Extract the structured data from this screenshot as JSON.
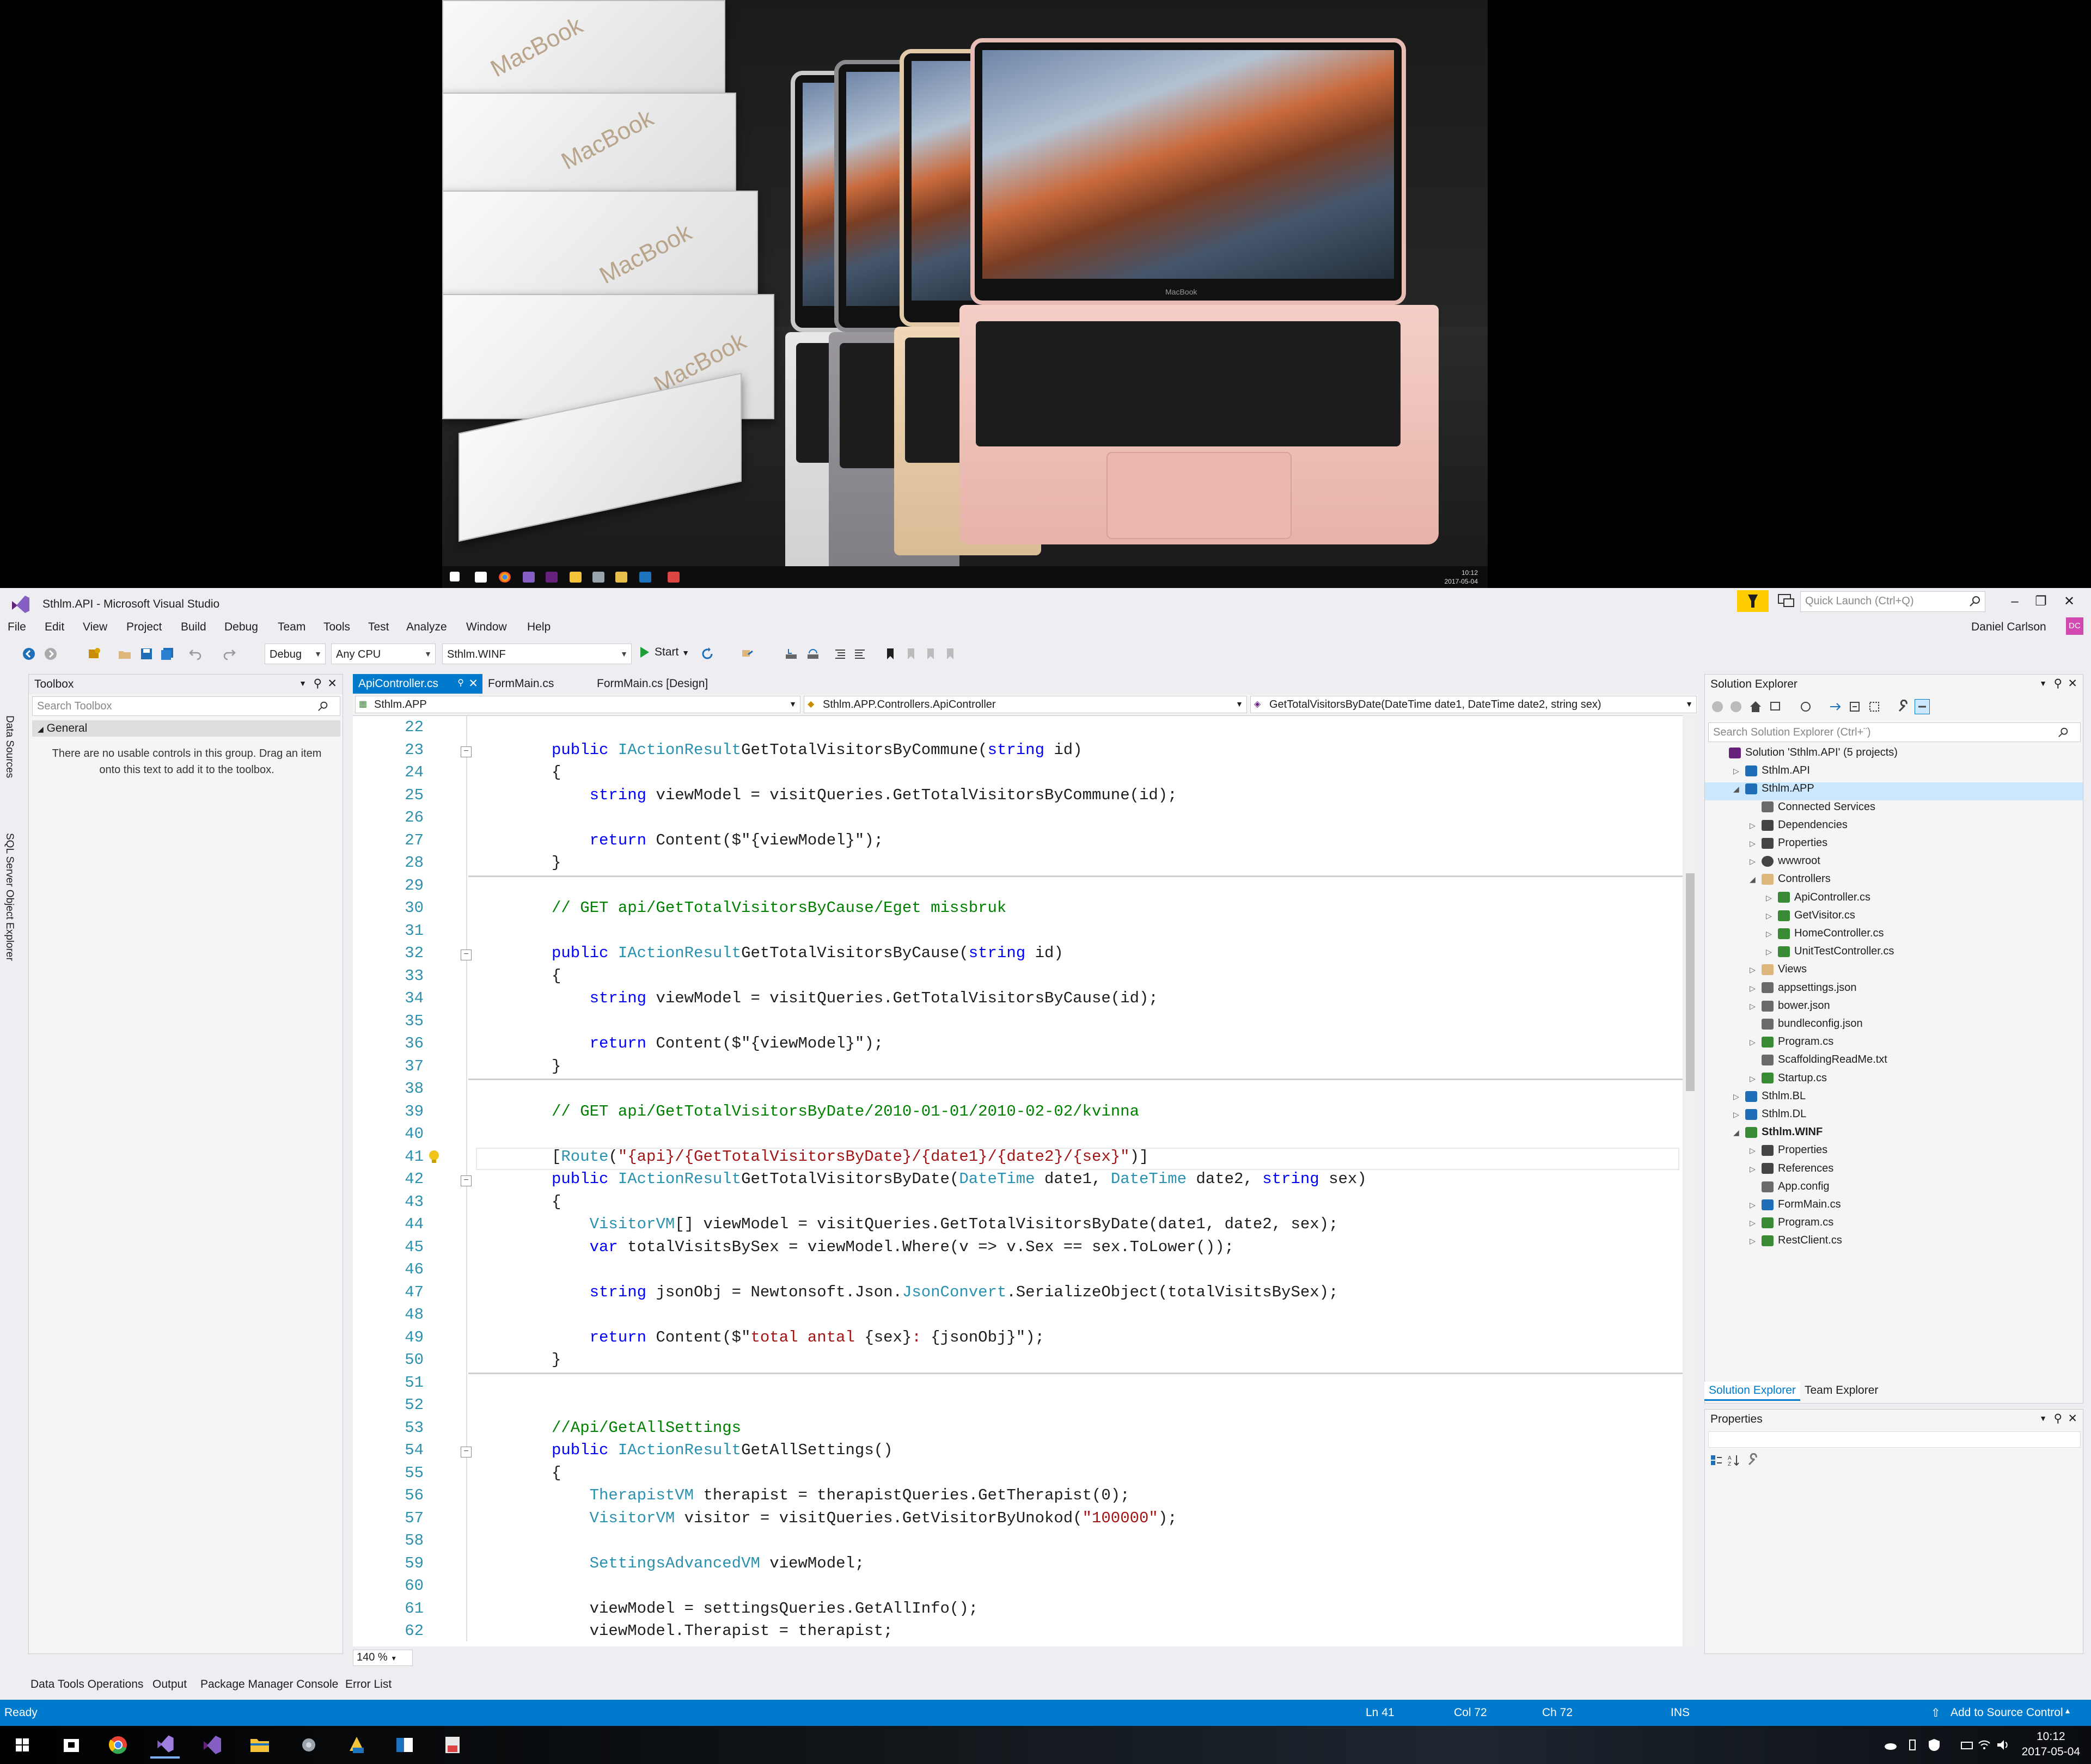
{
  "top_monitor": {
    "box_brand": "MacBook",
    "laptop_brand": "MacBook",
    "taskbar_time": "10:12",
    "taskbar_date": "2017-05-04"
  },
  "vs": {
    "window_title": "Sthlm.API - Microsoft Visual Studio",
    "quick_launch_placeholder": "Quick Launch (Ctrl+Q)",
    "user_name": "Daniel Carlson",
    "user_initials": "DC",
    "menu": [
      "File",
      "Edit",
      "View",
      "Project",
      "Build",
      "Debug",
      "Team",
      "Tools",
      "Test",
      "Analyze",
      "Window",
      "Help"
    ],
    "toolbar": {
      "config": "Debug",
      "platform": "Any CPU",
      "startup_project": "Sthlm.WINF",
      "start_label": "Start"
    },
    "side_tabs": [
      "Data Sources",
      "SQL Server Object Explorer"
    ],
    "toolbox": {
      "title": "Toolbox",
      "search_placeholder": "Search Toolbox",
      "group": "General",
      "empty_text": "There are no usable controls in this group. Drag an item onto this text to add it to the toolbox."
    },
    "doc_tabs": [
      "ApiController.cs",
      "FormMain.cs",
      "FormMain.cs [Design]"
    ],
    "nav": {
      "project": "Sthlm.APP",
      "class": "Sthlm.APP.Controllers.ApiController",
      "member": "GetTotalVisitorsByDate(DateTime date1, DateTime date2, string sex)"
    },
    "zoom": "140 %",
    "code_lines": [
      {
        "n": "22",
        "segs": []
      },
      {
        "n": "23",
        "segs": [
          [
            "kw",
            "public "
          ],
          [
            "ty",
            "IActionResult"
          ],
          [
            "",
            "GetTotalVisitorsByCommune("
          ],
          [
            "kw",
            "string"
          ],
          [
            "",
            " id)"
          ]
        ]
      },
      {
        "n": "24",
        "segs": [
          [
            "",
            "{"
          ]
        ]
      },
      {
        "n": "25",
        "segs": [
          [
            "",
            "    "
          ],
          [
            "kw",
            "string"
          ],
          [
            "",
            " viewModel = visitQueries.GetTotalVisitorsByCommune(id);"
          ]
        ]
      },
      {
        "n": "26",
        "segs": []
      },
      {
        "n": "27",
        "segs": [
          [
            "",
            "    "
          ],
          [
            "kw",
            "return"
          ],
          [
            "",
            " Content($\""
          ],
          [
            "",
            "{viewModel}"
          ],
          [
            "",
            "\");"
          ]
        ]
      },
      {
        "n": "28",
        "segs": [
          [
            "",
            "}"
          ]
        ]
      },
      {
        "n": "29",
        "segs": []
      },
      {
        "n": "30",
        "segs": [
          [
            "cm",
            "// GET api/GetTotalVisitorsByCause/Eget missbruk"
          ]
        ]
      },
      {
        "n": "31",
        "segs": []
      },
      {
        "n": "32",
        "segs": [
          [
            "kw",
            "public "
          ],
          [
            "ty",
            "IActionResult"
          ],
          [
            "",
            "GetTotalVisitorsByCause("
          ],
          [
            "kw",
            "string"
          ],
          [
            "",
            " id)"
          ]
        ]
      },
      {
        "n": "33",
        "segs": [
          [
            "",
            "{"
          ]
        ]
      },
      {
        "n": "34",
        "segs": [
          [
            "",
            "    "
          ],
          [
            "kw",
            "string"
          ],
          [
            "",
            " viewModel = visitQueries.GetTotalVisitorsByCause(id);"
          ]
        ]
      },
      {
        "n": "35",
        "segs": []
      },
      {
        "n": "36",
        "segs": [
          [
            "",
            "    "
          ],
          [
            "kw",
            "return"
          ],
          [
            "",
            " Content($\""
          ],
          [
            "",
            "{viewModel}"
          ],
          [
            "",
            "\");"
          ]
        ]
      },
      {
        "n": "37",
        "segs": [
          [
            "",
            "}"
          ]
        ]
      },
      {
        "n": "38",
        "segs": []
      },
      {
        "n": "39",
        "segs": [
          [
            "cm",
            "// GET api/GetTotalVisitorsByDate/2010-01-01/2010-02-02/kvinna"
          ]
        ]
      },
      {
        "n": "40",
        "segs": []
      },
      {
        "n": "41",
        "segs": [
          [
            "",
            "["
          ],
          [
            "ty",
            "Route"
          ],
          [
            "",
            "("
          ],
          [
            "st",
            "\"{api}/{GetTotalVisitorsByDate}/{date1}/{date2}/{sex}\""
          ],
          [
            "",
            ")]"
          ]
        ]
      },
      {
        "n": "42",
        "segs": [
          [
            "kw",
            "public "
          ],
          [
            "ty",
            "IActionResult"
          ],
          [
            "",
            "GetTotalVisitorsByDate("
          ],
          [
            "ty",
            "DateTime"
          ],
          [
            "",
            " date1, "
          ],
          [
            "ty",
            "DateTime"
          ],
          [
            "",
            " date2, "
          ],
          [
            "kw",
            "string"
          ],
          [
            "",
            " sex)"
          ]
        ]
      },
      {
        "n": "43",
        "segs": [
          [
            "",
            "{"
          ]
        ]
      },
      {
        "n": "44",
        "segs": [
          [
            "",
            "    "
          ],
          [
            "ty",
            "VisitorVM"
          ],
          [
            "",
            "[] viewModel = visitQueries.GetTotalVisitorsByDate(date1, date2, sex);"
          ]
        ]
      },
      {
        "n": "45",
        "segs": [
          [
            "",
            "    "
          ],
          [
            "kw",
            "var"
          ],
          [
            "",
            " totalVisitsBySex = viewModel.Where(v => v.Sex == sex.ToLower());"
          ]
        ]
      },
      {
        "n": "46",
        "segs": []
      },
      {
        "n": "47",
        "segs": [
          [
            "",
            "    "
          ],
          [
            "kw",
            "string"
          ],
          [
            "",
            " jsonObj = Newtonsoft.Json."
          ],
          [
            "ty",
            "JsonConvert"
          ],
          [
            "",
            ".SerializeObject(totalVisitsBySex);"
          ]
        ]
      },
      {
        "n": "48",
        "segs": []
      },
      {
        "n": "49",
        "segs": [
          [
            "",
            "    "
          ],
          [
            "kw",
            "return"
          ],
          [
            "",
            " Content($\""
          ],
          [
            "st",
            "total antal "
          ],
          [
            "",
            "{sex}"
          ],
          [
            "st",
            ": "
          ],
          [
            "",
            "{jsonObj}"
          ],
          [
            "",
            "\");"
          ]
        ]
      },
      {
        "n": "50",
        "segs": [
          [
            "",
            "}"
          ]
        ]
      },
      {
        "n": "51",
        "segs": []
      },
      {
        "n": "52",
        "segs": []
      },
      {
        "n": "53",
        "segs": [
          [
            "cm",
            "//Api/GetAllSettings"
          ]
        ]
      },
      {
        "n": "54",
        "segs": [
          [
            "kw",
            "public "
          ],
          [
            "ty",
            "IActionResult"
          ],
          [
            "",
            "GetAllSettings()"
          ]
        ]
      },
      {
        "n": "55",
        "segs": [
          [
            "",
            "{"
          ]
        ]
      },
      {
        "n": "56",
        "segs": [
          [
            "",
            "    "
          ],
          [
            "ty",
            "TherapistVM"
          ],
          [
            "",
            " therapist = therapistQueries.GetTherapist(0);"
          ]
        ]
      },
      {
        "n": "57",
        "segs": [
          [
            "",
            "    "
          ],
          [
            "ty",
            "VisitorVM"
          ],
          [
            "",
            " visitor = visitQueries.GetVisitorByUnokod("
          ],
          [
            "st",
            "\"100000\""
          ],
          [
            "",
            ");"
          ]
        ]
      },
      {
        "n": "58",
        "segs": []
      },
      {
        "n": "59",
        "segs": [
          [
            "",
            "    "
          ],
          [
            "ty",
            "SettingsAdvancedVM"
          ],
          [
            "",
            " viewModel;"
          ]
        ]
      },
      {
        "n": "60",
        "segs": []
      },
      {
        "n": "61",
        "segs": [
          [
            "",
            "    viewModel = settingsQueries.GetAllInfo();"
          ]
        ]
      },
      {
        "n": "62",
        "segs": [
          [
            "",
            "    viewModel.Therapist = therapist;"
          ]
        ]
      }
    ],
    "solution_explorer": {
      "title": "Solution Explorer",
      "search_placeholder": "Search Solution Explorer (Ctrl+¨)",
      "items": [
        {
          "label": "Solution 'Sthlm.API' (5 projects)",
          "level": 0,
          "exp": "",
          "icon": "solution-icon",
          "color": "#68217a",
          "bold": false
        },
        {
          "label": "Sthlm.API",
          "level": 1,
          "exp": "▷",
          "icon": "web-project-icon",
          "color": "#1e6fb8",
          "bold": false
        },
        {
          "label": "Sthlm.APP",
          "level": 1,
          "exp": "◢",
          "icon": "web-project-icon",
          "color": "#1e6fb8",
          "bold": false
        },
        {
          "label": "Connected Services",
          "level": 2,
          "exp": "",
          "icon": "connected-services-icon",
          "color": "#6a6a6a",
          "bold": false
        },
        {
          "label": "Dependencies",
          "level": 2,
          "exp": "▷",
          "icon": "dependencies-icon",
          "color": "#444444",
          "bold": false
        },
        {
          "label": "Properties",
          "level": 2,
          "exp": "▷",
          "icon": "wrench-icon",
          "color": "#444444",
          "bold": false
        },
        {
          "label": "wwwroot",
          "level": 2,
          "exp": "▷",
          "icon": "globe-icon",
          "color": "#444444",
          "bold": false
        },
        {
          "label": "Controllers",
          "level": 2,
          "exp": "◢",
          "icon": "folder-icon",
          "color": "#dcb67a",
          "bold": false
        },
        {
          "label": "ApiController.cs",
          "level": 3,
          "exp": "▷",
          "icon": "csharp-file-icon",
          "color": "#388a34",
          "bold": false
        },
        {
          "label": "GetVisitor.cs",
          "level": 3,
          "exp": "▷",
          "icon": "csharp-file-icon",
          "color": "#388a34",
          "bold": false
        },
        {
          "label": "HomeController.cs",
          "level": 3,
          "exp": "▷",
          "icon": "csharp-file-icon",
          "color": "#388a34",
          "bold": false
        },
        {
          "label": "UnitTestController.cs",
          "level": 3,
          "exp": "▷",
          "icon": "csharp-file-icon",
          "color": "#388a34",
          "bold": false
        },
        {
          "label": "Views",
          "level": 2,
          "exp": "▷",
          "icon": "folder-icon",
          "color": "#dcb67a",
          "bold": false
        },
        {
          "label": "appsettings.json",
          "level": 2,
          "exp": "▷",
          "icon": "json-file-icon",
          "color": "#6a6a6a",
          "bold": false
        },
        {
          "label": "bower.json",
          "level": 2,
          "exp": "▷",
          "icon": "json-file-icon",
          "color": "#6a6a6a",
          "bold": false
        },
        {
          "label": "bundleconfig.json",
          "level": 2,
          "exp": "",
          "icon": "json-file-icon",
          "color": "#6a6a6a",
          "bold": false
        },
        {
          "label": "Program.cs",
          "level": 2,
          "exp": "▷",
          "icon": "csharp-file-icon",
          "color": "#388a34",
          "bold": false
        },
        {
          "label": "ScaffoldingReadMe.txt",
          "level": 2,
          "exp": "",
          "icon": "text-file-icon",
          "color": "#6a6a6a",
          "bold": false
        },
        {
          "label": "Startup.cs",
          "level": 2,
          "exp": "▷",
          "icon": "csharp-file-icon",
          "color": "#388a34",
          "bold": false
        },
        {
          "label": "Sthlm.BL",
          "level": 1,
          "exp": "▷",
          "icon": "class-library-icon",
          "color": "#1e6fb8",
          "bold": false
        },
        {
          "label": "Sthlm.DL",
          "level": 1,
          "exp": "▷",
          "icon": "class-library-icon",
          "color": "#1e6fb8",
          "bold": false
        },
        {
          "label": "Sthlm.WINF",
          "level": 1,
          "exp": "◢",
          "icon": "winforms-project-icon",
          "color": "#388a34",
          "bold": true
        },
        {
          "label": "Properties",
          "level": 2,
          "exp": "▷",
          "icon": "wrench-icon",
          "color": "#444444",
          "bold": false
        },
        {
          "label": "References",
          "level": 2,
          "exp": "▷",
          "icon": "references-icon",
          "color": "#444444",
          "bold": false
        },
        {
          "label": "App.config",
          "level": 2,
          "exp": "",
          "icon": "config-file-icon",
          "color": "#6a6a6a",
          "bold": false
        },
        {
          "label": "FormMain.cs",
          "level": 2,
          "exp": "▷",
          "icon": "form-file-icon",
          "color": "#1e6fb8",
          "bold": false
        },
        {
          "label": "Program.cs",
          "level": 2,
          "exp": "▷",
          "icon": "csharp-file-icon",
          "color": "#388a34",
          "bold": false
        },
        {
          "label": "RestClient.cs",
          "level": 2,
          "exp": "▷",
          "icon": "csharp-file-icon",
          "color": "#388a34",
          "bold": false
        }
      ],
      "tabs": [
        "Solution Explorer",
        "Team Explorer"
      ]
    },
    "properties_title": "Properties",
    "bottom_tabs": [
      "Data Tools Operations",
      "Output",
      "Package Manager Console",
      "Error List"
    ],
    "status": {
      "ready": "Ready",
      "ln": "Ln 41",
      "col": "Col 72",
      "ch": "Ch 72",
      "ins": "INS",
      "source_control": "Add to Source Control"
    }
  },
  "os_taskbar": {
    "time": "10:12",
    "date": "2017-05-04"
  },
  "colors": {
    "accent": "#007acc",
    "keyword": "#0000ff",
    "type": "#2b91af",
    "string": "#a31515",
    "comment": "#008000",
    "notification": "#ffcc00"
  }
}
